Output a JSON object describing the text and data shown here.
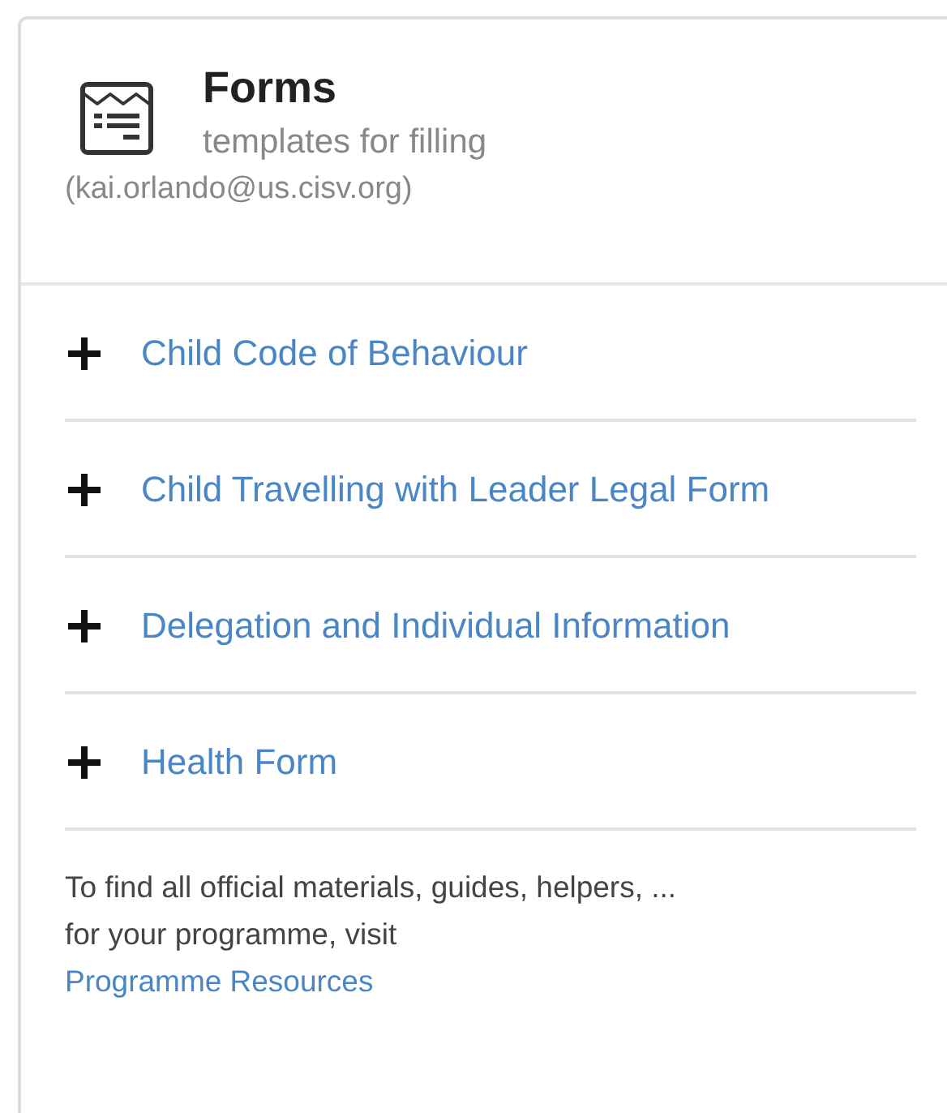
{
  "card": {
    "title": "Forms",
    "subtitle": "templates for filling",
    "account": "(kai.orlando@us.cisv.org)"
  },
  "forms": [
    {
      "label": "Child Code of Behaviour",
      "expanded": false
    },
    {
      "label": "Child Travelling with Leader Legal Form",
      "expanded": false
    },
    {
      "label": "Delegation and Individual Information",
      "expanded": false
    },
    {
      "label": "Health Form",
      "expanded": false
    }
  ],
  "footer": {
    "text": "To find all official materials, guides, helpers, ... for your programme, visit",
    "link": "Programme Resources"
  }
}
